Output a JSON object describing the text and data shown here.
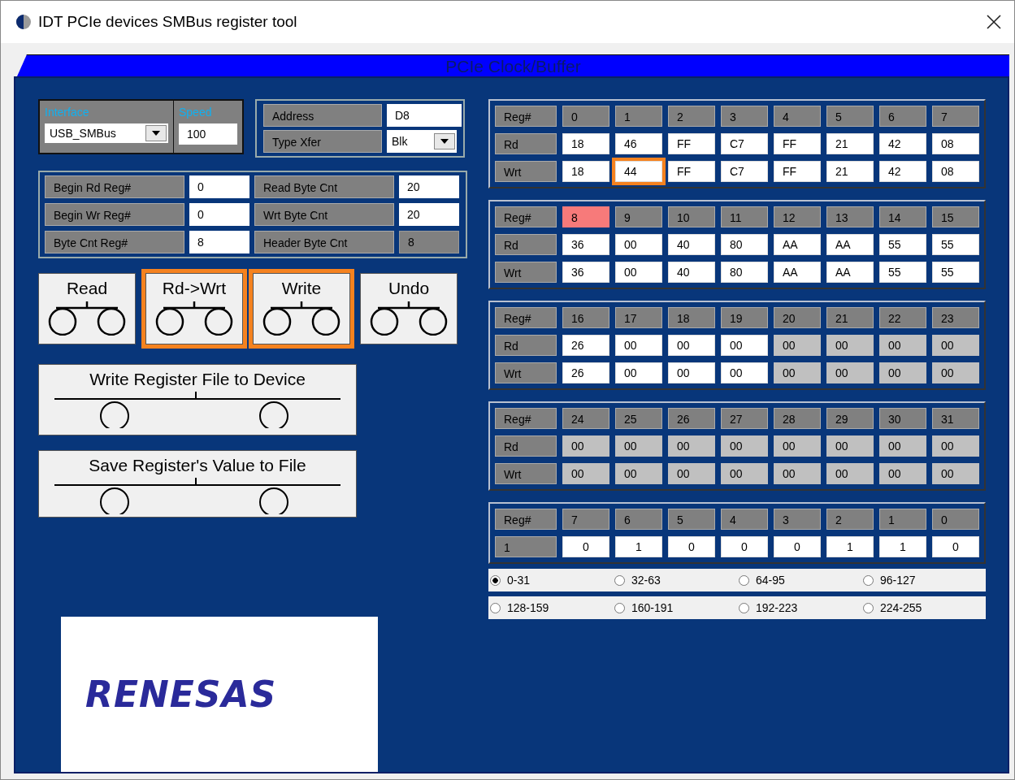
{
  "window": {
    "title": "IDT PCIe devices SMBus register tool"
  },
  "panel": {
    "title": "PCIe Clock/Buffer"
  },
  "connection": {
    "interface_label": "Interface",
    "interface_value": "USB_SMBus",
    "speed_label": "Speed",
    "speed_value": "100"
  },
  "target": [
    {
      "label": "Address",
      "value": "D8",
      "kind": "text"
    },
    {
      "label": "Type Xfer",
      "value": "Blk",
      "kind": "dropdown"
    }
  ],
  "settings": [
    {
      "label": "Begin Rd Reg#",
      "value": "0",
      "disabled": false
    },
    {
      "label": "Read Byte Cnt",
      "value": "20",
      "disabled": false
    },
    {
      "label": "Begin Wr Reg#",
      "value": "0",
      "disabled": false
    },
    {
      "label": "Wrt Byte Cnt",
      "value": "20",
      "disabled": false
    },
    {
      "label": "Byte Cnt Reg#",
      "value": "8",
      "disabled": false
    },
    {
      "label": "Header Byte Cnt",
      "value": "8",
      "disabled": true
    }
  ],
  "buttons": [
    {
      "label": "Read",
      "highlighted": false
    },
    {
      "label": "Rd->Wrt",
      "highlighted": true
    },
    {
      "label": "Write",
      "highlighted": true
    },
    {
      "label": "Undo",
      "highlighted": false
    }
  ],
  "file_buttons": [
    "Write  Register File to Device",
    "Save  Register's Value to File"
  ],
  "logo": {
    "text": "RENESAS"
  },
  "register_blocks": [
    {
      "header": "Reg#",
      "regs": [
        {
          "label": "0",
          "highlighted": false
        },
        {
          "label": "1",
          "highlighted": false
        },
        {
          "label": "2",
          "highlighted": false
        },
        {
          "label": "3",
          "highlighted": false
        },
        {
          "label": "4",
          "highlighted": false
        },
        {
          "label": "5",
          "highlighted": false
        },
        {
          "label": "6",
          "highlighted": false
        },
        {
          "label": "7",
          "highlighted": false
        }
      ],
      "rows": [
        {
          "label": "Rd",
          "cells": [
            {
              "value": "18",
              "disabled": false,
              "highlighted": false
            },
            {
              "value": "46",
              "disabled": false,
              "highlighted": false
            },
            {
              "value": "FF",
              "disabled": false,
              "highlighted": false
            },
            {
              "value": "C7",
              "disabled": false,
              "highlighted": false
            },
            {
              "value": "FF",
              "disabled": false,
              "highlighted": false
            },
            {
              "value": "21",
              "disabled": false,
              "highlighted": false
            },
            {
              "value": "42",
              "disabled": false,
              "highlighted": false
            },
            {
              "value": "08",
              "disabled": false,
              "highlighted": false
            }
          ]
        },
        {
          "label": "Wrt",
          "cells": [
            {
              "value": "18",
              "disabled": false,
              "highlighted": false
            },
            {
              "value": "44",
              "disabled": false,
              "highlighted": true
            },
            {
              "value": "FF",
              "disabled": false,
              "highlighted": false
            },
            {
              "value": "C7",
              "disabled": false,
              "highlighted": false
            },
            {
              "value": "FF",
              "disabled": false,
              "highlighted": false
            },
            {
              "value": "21",
              "disabled": false,
              "highlighted": false
            },
            {
              "value": "42",
              "disabled": false,
              "highlighted": false
            },
            {
              "value": "08",
              "disabled": false,
              "highlighted": false
            }
          ]
        }
      ]
    },
    {
      "header": "Reg#",
      "regs": [
        {
          "label": "8",
          "highlighted": true
        },
        {
          "label": "9",
          "highlighted": false
        },
        {
          "label": "10",
          "highlighted": false
        },
        {
          "label": "11",
          "highlighted": false
        },
        {
          "label": "12",
          "highlighted": false
        },
        {
          "label": "13",
          "highlighted": false
        },
        {
          "label": "14",
          "highlighted": false
        },
        {
          "label": "15",
          "highlighted": false
        }
      ],
      "rows": [
        {
          "label": "Rd",
          "cells": [
            {
              "value": "36",
              "disabled": false,
              "highlighted": false
            },
            {
              "value": "00",
              "disabled": false,
              "highlighted": false
            },
            {
              "value": "40",
              "disabled": false,
              "highlighted": false
            },
            {
              "value": "80",
              "disabled": false,
              "highlighted": false
            },
            {
              "value": "AA",
              "disabled": false,
              "highlighted": false
            },
            {
              "value": "AA",
              "disabled": false,
              "highlighted": false
            },
            {
              "value": "55",
              "disabled": false,
              "highlighted": false
            },
            {
              "value": "55",
              "disabled": false,
              "highlighted": false
            }
          ]
        },
        {
          "label": "Wrt",
          "cells": [
            {
              "value": "36",
              "disabled": false,
              "highlighted": false
            },
            {
              "value": "00",
              "disabled": false,
              "highlighted": false
            },
            {
              "value": "40",
              "disabled": false,
              "highlighted": false
            },
            {
              "value": "80",
              "disabled": false,
              "highlighted": false
            },
            {
              "value": "AA",
              "disabled": false,
              "highlighted": false
            },
            {
              "value": "AA",
              "disabled": false,
              "highlighted": false
            },
            {
              "value": "55",
              "disabled": false,
              "highlighted": false
            },
            {
              "value": "55",
              "disabled": false,
              "highlighted": false
            }
          ]
        }
      ]
    },
    {
      "header": "Reg#",
      "regs": [
        {
          "label": "16",
          "highlighted": false
        },
        {
          "label": "17",
          "highlighted": false
        },
        {
          "label": "18",
          "highlighted": false
        },
        {
          "label": "19",
          "highlighted": false
        },
        {
          "label": "20",
          "highlighted": false
        },
        {
          "label": "21",
          "highlighted": false
        },
        {
          "label": "22",
          "highlighted": false
        },
        {
          "label": "23",
          "highlighted": false
        }
      ],
      "rows": [
        {
          "label": "Rd",
          "cells": [
            {
              "value": "26",
              "disabled": false,
              "highlighted": false
            },
            {
              "value": "00",
              "disabled": false,
              "highlighted": false
            },
            {
              "value": "00",
              "disabled": false,
              "highlighted": false
            },
            {
              "value": "00",
              "disabled": false,
              "highlighted": false
            },
            {
              "value": "00",
              "disabled": true,
              "highlighted": false
            },
            {
              "value": "00",
              "disabled": true,
              "highlighted": false
            },
            {
              "value": "00",
              "disabled": true,
              "highlighted": false
            },
            {
              "value": "00",
              "disabled": true,
              "highlighted": false
            }
          ]
        },
        {
          "label": "Wrt",
          "cells": [
            {
              "value": "26",
              "disabled": false,
              "highlighted": false
            },
            {
              "value": "00",
              "disabled": false,
              "highlighted": false
            },
            {
              "value": "00",
              "disabled": false,
              "highlighted": false
            },
            {
              "value": "00",
              "disabled": false,
              "highlighted": false
            },
            {
              "value": "00",
              "disabled": true,
              "highlighted": false
            },
            {
              "value": "00",
              "disabled": true,
              "highlighted": false
            },
            {
              "value": "00",
              "disabled": true,
              "highlighted": false
            },
            {
              "value": "00",
              "disabled": true,
              "highlighted": false
            }
          ]
        }
      ]
    },
    {
      "header": "Reg#",
      "regs": [
        {
          "label": "24",
          "highlighted": false
        },
        {
          "label": "25",
          "highlighted": false
        },
        {
          "label": "26",
          "highlighted": false
        },
        {
          "label": "27",
          "highlighted": false
        },
        {
          "label": "28",
          "highlighted": false
        },
        {
          "label": "29",
          "highlighted": false
        },
        {
          "label": "30",
          "highlighted": false
        },
        {
          "label": "31",
          "highlighted": false
        }
      ],
      "rows": [
        {
          "label": "Rd",
          "cells": [
            {
              "value": "00",
              "disabled": true,
              "highlighted": false
            },
            {
              "value": "00",
              "disabled": true,
              "highlighted": false
            },
            {
              "value": "00",
              "disabled": true,
              "highlighted": false
            },
            {
              "value": "00",
              "disabled": true,
              "highlighted": false
            },
            {
              "value": "00",
              "disabled": true,
              "highlighted": false
            },
            {
              "value": "00",
              "disabled": true,
              "highlighted": false
            },
            {
              "value": "00",
              "disabled": true,
              "highlighted": false
            },
            {
              "value": "00",
              "disabled": true,
              "highlighted": false
            }
          ]
        },
        {
          "label": "Wrt",
          "cells": [
            {
              "value": "00",
              "disabled": true,
              "highlighted": false
            },
            {
              "value": "00",
              "disabled": true,
              "highlighted": false
            },
            {
              "value": "00",
              "disabled": true,
              "highlighted": false
            },
            {
              "value": "00",
              "disabled": true,
              "highlighted": false
            },
            {
              "value": "00",
              "disabled": true,
              "highlighted": false
            },
            {
              "value": "00",
              "disabled": true,
              "highlighted": false
            },
            {
              "value": "00",
              "disabled": true,
              "highlighted": false
            },
            {
              "value": "00",
              "disabled": true,
              "highlighted": false
            }
          ]
        }
      ]
    }
  ],
  "bits": {
    "header": "Reg#",
    "bit_labels": [
      "7",
      "6",
      "5",
      "4",
      "3",
      "2",
      "1",
      "0"
    ],
    "row_label": "1",
    "values": [
      "0",
      "1",
      "0",
      "0",
      "0",
      "1",
      "1",
      "0"
    ]
  },
  "ranges": [
    {
      "label": "0-31",
      "selected": true
    },
    {
      "label": "32-63",
      "selected": false
    },
    {
      "label": "64-95",
      "selected": false
    },
    {
      "label": "96-127",
      "selected": false
    },
    {
      "label": "128-159",
      "selected": false
    },
    {
      "label": "160-191",
      "selected": false
    },
    {
      "label": "192-223",
      "selected": false
    },
    {
      "label": "224-255",
      "selected": false
    }
  ]
}
